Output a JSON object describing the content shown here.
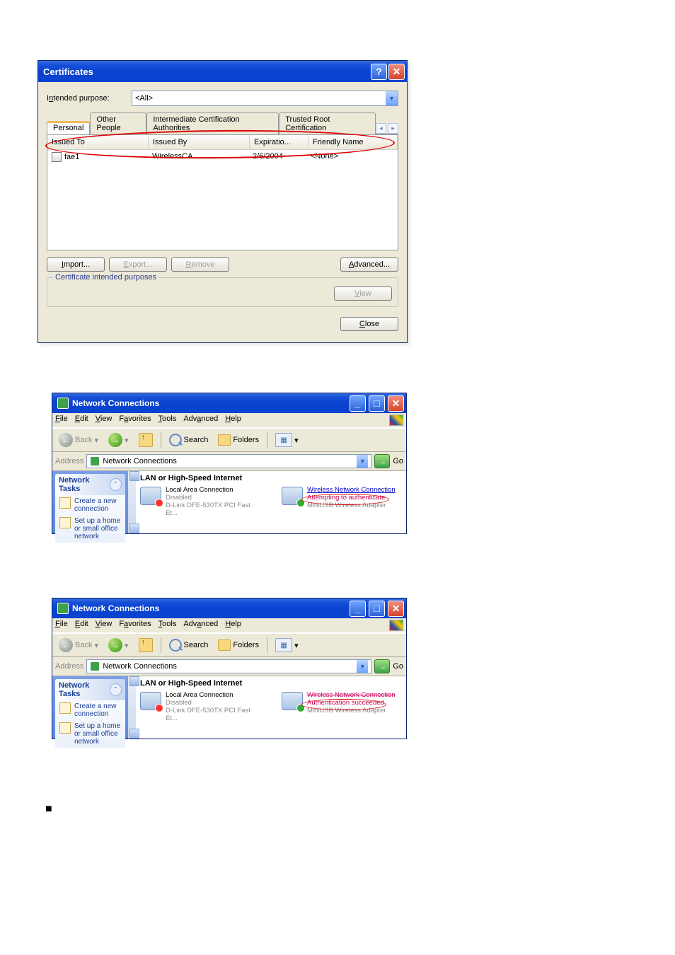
{
  "cert_dialog": {
    "title": "Certificates",
    "intended_label_pre": "I",
    "intended_label_ul": "n",
    "intended_label_post": "tended purpose:",
    "purpose_value": "<All>",
    "tabs": [
      "Personal",
      "Other People",
      "Intermediate Certification Authorities",
      "Trusted Root Certification"
    ],
    "columns": {
      "c1": "Issued To",
      "c2": "Issued By",
      "c3": "Expiratio...",
      "c4": "Friendly Name"
    },
    "row": {
      "to": "fae1",
      "by": "WirelessCA",
      "exp": "2/6/2004",
      "fn": "<None>"
    },
    "buttons": {
      "import_ul": "I",
      "import_rest": "mport...",
      "export_ul": "E",
      "export_rest": "xport...",
      "remove_ul": "R",
      "remove_rest": "emove",
      "advanced_ul": "A",
      "advanced_rest": "dvanced...",
      "view_ul": "V",
      "view_rest": "iew",
      "close_ul": "C",
      "close_rest": "lose"
    },
    "fieldset_legend": "Certificate intended purposes"
  },
  "nc_window": {
    "title": "Network Connections",
    "menus": {
      "file_u": "F",
      "file_r": "ile",
      "edit_u": "E",
      "edit_r": "dit",
      "view_u": "V",
      "view_r": "iew",
      "fav_r": "F",
      "fav_u": "a",
      "fav_r2": "vorites",
      "tools_u": "T",
      "tools_r": "ools",
      "adv_r": "Adv",
      "adv_u": "a",
      "adv_r2": "nced",
      "help_u": "H",
      "help_r": "elp"
    },
    "toolbar": {
      "back": "Back",
      "search": "Search",
      "folders": "Folders"
    },
    "address_label": "Address",
    "address_value": "Network Connections",
    "go": "Go",
    "sidebar_title": "Network Tasks",
    "sidebar_links": [
      "Create a new connection",
      "Set up a home or small office network"
    ],
    "category": "LAN or High-Speed Internet",
    "lan": {
      "name": "Local Area Connection",
      "status": "Disabled",
      "dev": "D-Link DFE-530TX PCI Fast Et..."
    },
    "wlan_a": {
      "name": "Wireless Network Connection",
      "status": "Attempting to authenticate",
      "dev": "MiniUSB Wireless Adapter"
    },
    "wlan_b": {
      "name": "Wireless Network Connection",
      "status": "Authentication succeeded",
      "dev": "MiniUSB Wireless Adapter"
    }
  },
  "bullet": "■"
}
